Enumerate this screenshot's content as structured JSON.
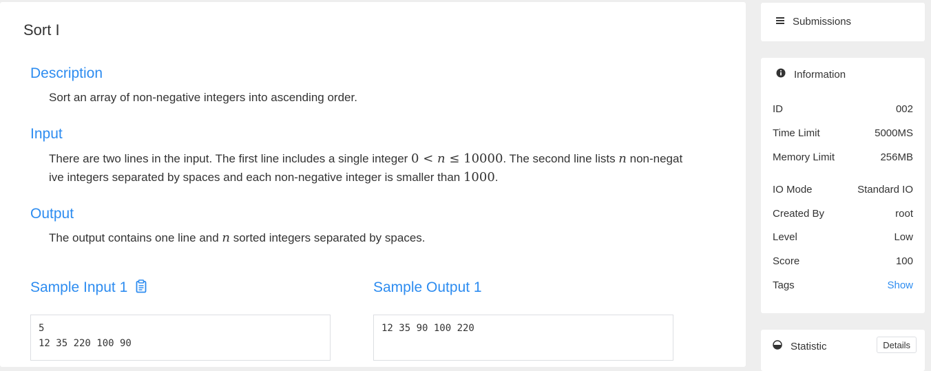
{
  "problem": {
    "title": "Sort I",
    "description": {
      "heading": "Description",
      "text": "Sort an array of non-negative integers into ascending order."
    },
    "input": {
      "heading": "Input",
      "t1": "There are two lines in the input. The first line includes a single integer ",
      "m1a": "0",
      "m1b": " < ",
      "m1c": "n",
      "m1d": " ≤ ",
      "m1e": "10000",
      "t2": ". The second line lists ",
      "m2": "n",
      "t3": " non-negat",
      "t4": "ive integers separated by spaces and each non-negative integer is smaller than ",
      "m3": "1000",
      "t5": "."
    },
    "output": {
      "heading": "Output",
      "t1": "The output contains one line and ",
      "m1": "n",
      "t2": " sorted integers separated by spaces."
    },
    "sample_input": {
      "heading": "Sample Input 1",
      "content": "5\n12 35 220 100 90"
    },
    "sample_output": {
      "heading": "Sample Output 1",
      "content": "12 35 90 100 220"
    }
  },
  "sidebar": {
    "submissions_label": "Submissions",
    "information_label": "Information",
    "info": [
      {
        "label": "ID",
        "value": "002"
      },
      {
        "label": "Time Limit",
        "value": "5000MS"
      },
      {
        "label": "Memory Limit",
        "value": "256MB"
      },
      {
        "label": "IO Mode",
        "value": "Standard IO"
      },
      {
        "label": "Created By",
        "value": "root"
      },
      {
        "label": "Level",
        "value": "Low"
      },
      {
        "label": "Score",
        "value": "100"
      },
      {
        "label": "Tags",
        "value": "Show"
      }
    ],
    "statistic_label": "Statistic",
    "details_label": "Details"
  },
  "colors": {
    "accent": "#2d8cf0",
    "background": "#eeeeee"
  }
}
